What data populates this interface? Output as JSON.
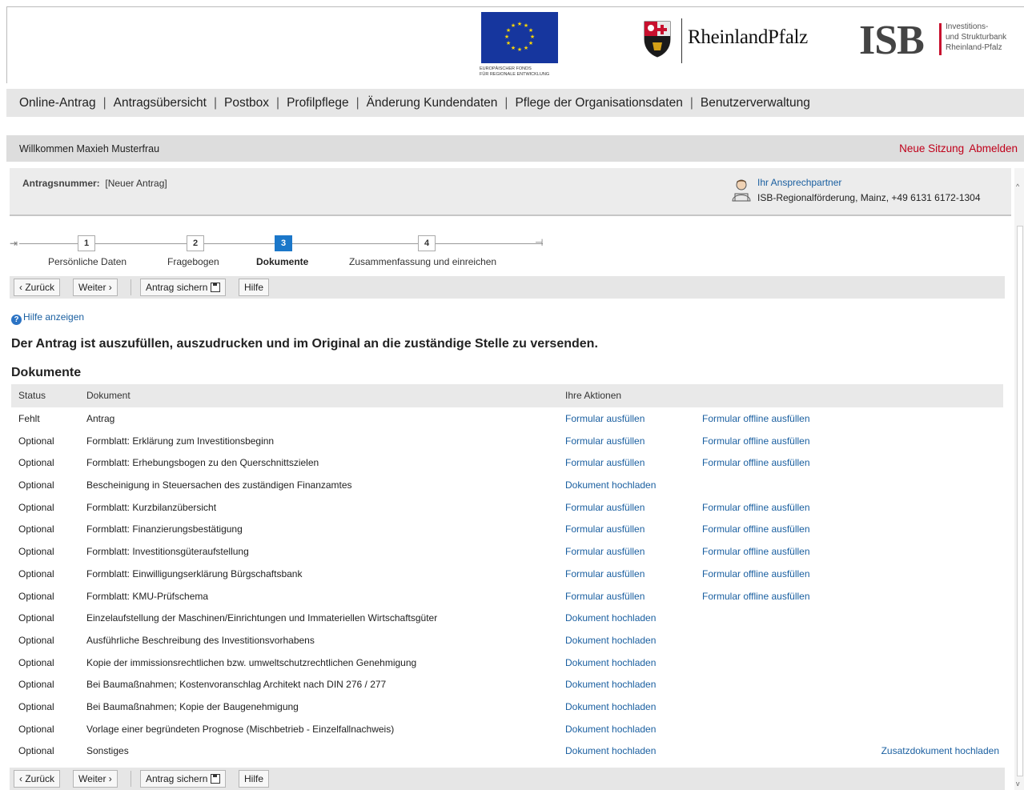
{
  "header": {
    "eu_caption_line1": "Europäischer Fonds",
    "eu_caption_line2": "für regionale Entwicklung",
    "rlp_name": "RheinlandPfalz",
    "isb_name": "ISB",
    "isb_sub1": "Investitions-",
    "isb_sub2": "und Strukturbank",
    "isb_sub3": "Rheinland-Pfalz",
    "eu_flag_color": "#16369e",
    "isb_accent": "#c8102e"
  },
  "nav": {
    "items": [
      "Online-Antrag",
      "Antragsübersicht",
      "Postbox",
      "Profilpflege",
      "Änderung Kundendaten",
      "Pflege der Organisationsdaten",
      "Benutzerverwaltung"
    ],
    "separator": "|"
  },
  "welcome": {
    "text": "Willkommen Maxieh Musterfrau",
    "new_session": "Neue Sitzung",
    "logout": "Abmelden"
  },
  "antrag": {
    "number_label": "Antragsnummer:",
    "number_value": "[Neuer Antrag]",
    "contact_title": "Ihr Ansprechpartner",
    "contact_info": "ISB-Regionalförderung, Mainz, +49 6131 6172-1304"
  },
  "steps": [
    {
      "num": "1",
      "label": "Persönliche Daten",
      "active": false
    },
    {
      "num": "2",
      "label": "Fragebogen",
      "active": false
    },
    {
      "num": "3",
      "label": "Dokumente",
      "active": true
    },
    {
      "num": "4",
      "label": "Zusammenfassung und einreichen",
      "active": false
    }
  ],
  "toolbar": {
    "back": "Zurück",
    "next": "Weiter",
    "save": "Antrag sichern",
    "help": "Hilfe",
    "back_arrow": "‹",
    "next_arrow": "›"
  },
  "help_link": "Hilfe anzeigen",
  "headline": "Der Antrag ist auszufüllen, auszudrucken und im Original an die zuständige Stelle zu versenden.",
  "section_title": "Dokumente",
  "table": {
    "headers": {
      "status": "Status",
      "document": "Dokument",
      "actions": "Ihre Aktionen"
    },
    "rows": [
      {
        "status": "Fehlt",
        "document": "Antrag",
        "action1": "Formular ausfüllen",
        "action2": "Formular offline ausfüllen",
        "action3": ""
      },
      {
        "status": "Optional",
        "document": "Formblatt: Erklärung zum Investitionsbeginn",
        "action1": "Formular ausfüllen",
        "action2": "Formular offline ausfüllen",
        "action3": ""
      },
      {
        "status": "Optional",
        "document": "Formblatt: Erhebungsbogen zu den Querschnittszielen",
        "action1": "Formular ausfüllen",
        "action2": "Formular offline ausfüllen",
        "action3": ""
      },
      {
        "status": "Optional",
        "document": "Bescheinigung in Steuersachen des zuständigen Finanzamtes",
        "action1": "Dokument hochladen",
        "action2": "",
        "action3": ""
      },
      {
        "status": "Optional",
        "document": "Formblatt: Kurzbilanzübersicht",
        "action1": "Formular ausfüllen",
        "action2": "Formular offline ausfüllen",
        "action3": ""
      },
      {
        "status": "Optional",
        "document": "Formblatt: Finanzierungsbestätigung",
        "action1": "Formular ausfüllen",
        "action2": "Formular offline ausfüllen",
        "action3": ""
      },
      {
        "status": "Optional",
        "document": "Formblatt: Investitionsgüteraufstellung",
        "action1": "Formular ausfüllen",
        "action2": "Formular offline ausfüllen",
        "action3": ""
      },
      {
        "status": "Optional",
        "document": "Formblatt: Einwilligungserklärung Bürgschaftsbank",
        "action1": "Formular ausfüllen",
        "action2": "Formular offline ausfüllen",
        "action3": ""
      },
      {
        "status": "Optional",
        "document": "Formblatt: KMU-Prüfschema",
        "action1": "Formular ausfüllen",
        "action2": "Formular offline ausfüllen",
        "action3": ""
      },
      {
        "status": "Optional",
        "document": "Einzelaufstellung der Maschinen/Einrichtungen und Immateriellen Wirtschaftsgüter",
        "action1": "Dokument hochladen",
        "action2": "",
        "action3": ""
      },
      {
        "status": "Optional",
        "document": "Ausführliche Beschreibung des Investitionsvorhabens",
        "action1": "Dokument hochladen",
        "action2": "",
        "action3": ""
      },
      {
        "status": "Optional",
        "document": "Kopie der immissionsrechtlichen bzw. umweltschutzrechtlichen Genehmigung",
        "action1": "Dokument hochladen",
        "action2": "",
        "action3": ""
      },
      {
        "status": "Optional",
        "document": "Bei Baumaßnahmen; Kostenvoranschlag Architekt nach DIN 276 / 277",
        "action1": "Dokument hochladen",
        "action2": "",
        "action3": ""
      },
      {
        "status": "Optional",
        "document": "Bei Baumaßnahmen; Kopie der Baugenehmigung",
        "action1": "Dokument hochladen",
        "action2": "",
        "action3": ""
      },
      {
        "status": "Optional",
        "document": "Vorlage einer begründeten Prognose (Mischbetrieb - Einzelfallnachweis)",
        "action1": "Dokument hochladen",
        "action2": "",
        "action3": ""
      },
      {
        "status": "Optional",
        "document": "Sonstiges",
        "action1": "Dokument hochladen",
        "action2": "",
        "action3": "Zusatzdokument hochladen"
      }
    ]
  },
  "colors": {
    "link": "#1a5fa0",
    "session_links": "#c0001a",
    "active_step": "#1b77c9"
  }
}
